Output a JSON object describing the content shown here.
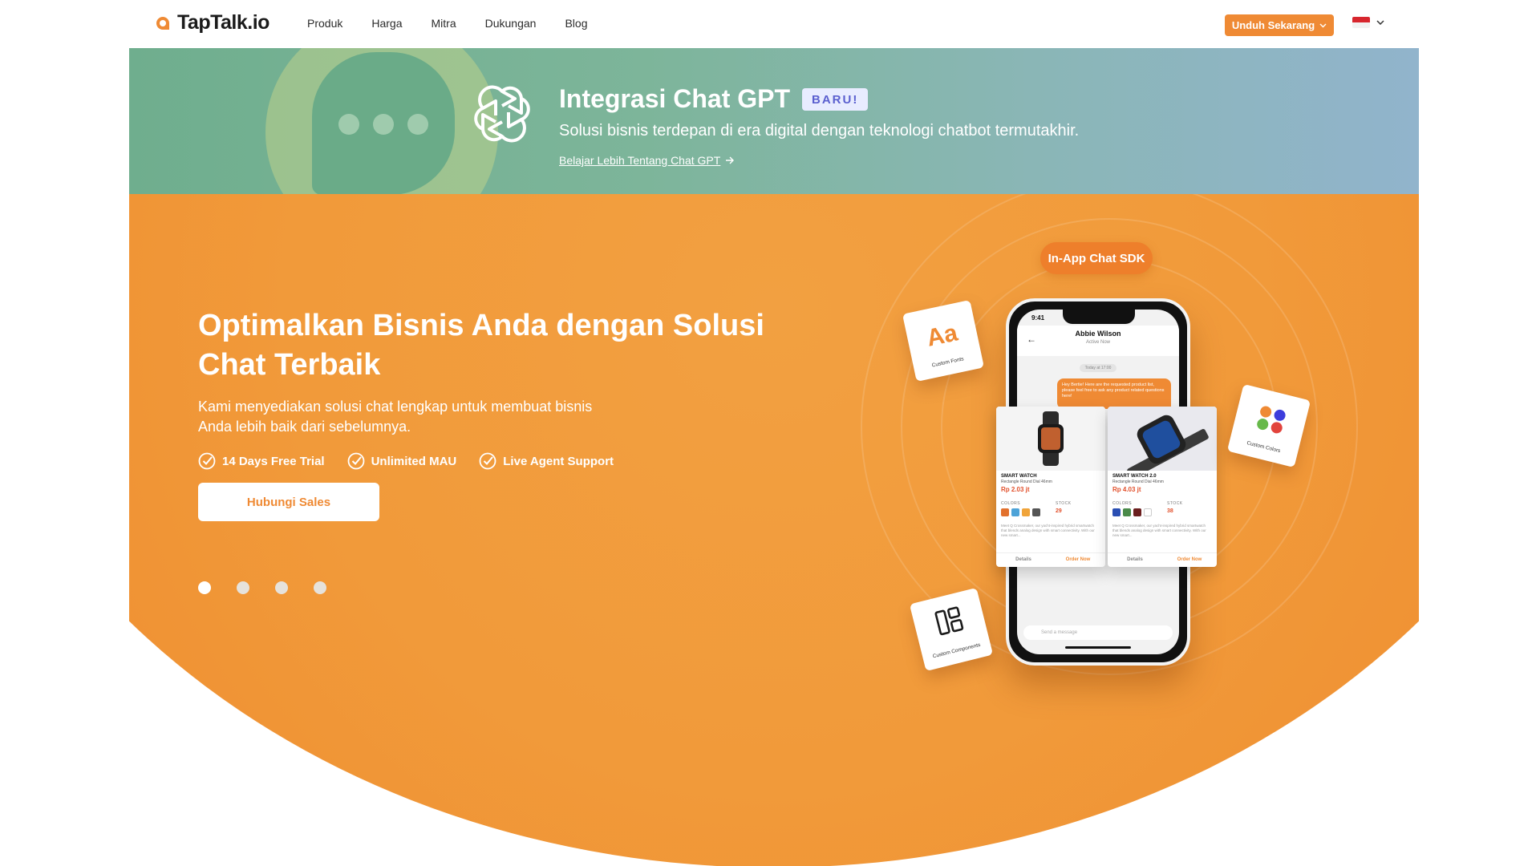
{
  "nav": {
    "logo_text": "TapTalk.io",
    "links": [
      "Produk",
      "Harga",
      "Mitra",
      "Dukungan",
      "Blog"
    ],
    "download_label": "Unduh Sekarang",
    "language_flag": "indonesia-flag-icon"
  },
  "banner": {
    "title": "Integrasi Chat GPT",
    "badge": "BARU!",
    "subtitle": "Solusi bisnis terdepan di era digital dengan teknologi chatbot termutakhir.",
    "link_label": "Belajar Lebih Tentang Chat GPT"
  },
  "hero": {
    "title": "Optimalkan Bisnis Anda dengan Solusi Chat Terbaik",
    "description": "Kami menyediakan solusi chat lengkap untuk membuat bisnis Anda lebih baik dari sebelumnya.",
    "features": [
      "14 Days Free Trial",
      "Unlimited MAU",
      "Live Agent Support"
    ],
    "cta_label": "Hubungi Sales",
    "slides": {
      "count": 4,
      "active_index": 0
    }
  },
  "illustration": {
    "sdk_label": "In-App Chat SDK",
    "phone": {
      "time": "9:41",
      "contact_name": "Abbie Wilson",
      "contact_status": "Active Now",
      "date_chip": "Today at 17:00",
      "message": "Hey Bertie! Here are the requested product list, please feel free to ask any product related questions here!",
      "input_placeholder": "Send a message"
    },
    "products": [
      {
        "title": "SMART WATCH",
        "subtitle": "Rectangle Round Dial 46mm",
        "price": "Rp 2.03 jt",
        "colors_label": "COLORS",
        "stock_label": "STOCK",
        "stock": "29",
        "description": "Meet Q Crossmaker, our yacht-inspired hybrid smartwatch that blends analog design with smart connectivity. With our new smart...",
        "details_label": "Details",
        "order_label": "Order Now"
      },
      {
        "title": "SMART WATCH 2.0",
        "subtitle": "Rectangle Round Dial 46mm",
        "price": "Rp 4.03 jt",
        "colors_label": "COLORS",
        "stock_label": "STOCK",
        "stock": "38",
        "description": "Meet Q Crossmaker, our yacht-inspired hybrid smartwatch that blends analog design with smart connectivity. With our new smart...",
        "details_label": "Details",
        "order_label": "Order Now"
      }
    ],
    "float_cards": {
      "fonts_glyph": "Aa",
      "fonts_label": "Custom Fonts",
      "colors_label": "Custom Colors",
      "components_label": "Custom Components"
    }
  },
  "colors": {
    "brand_orange": "#ef8a34",
    "badge_bg": "#e8ecff",
    "badge_text": "#5a5fcf"
  }
}
